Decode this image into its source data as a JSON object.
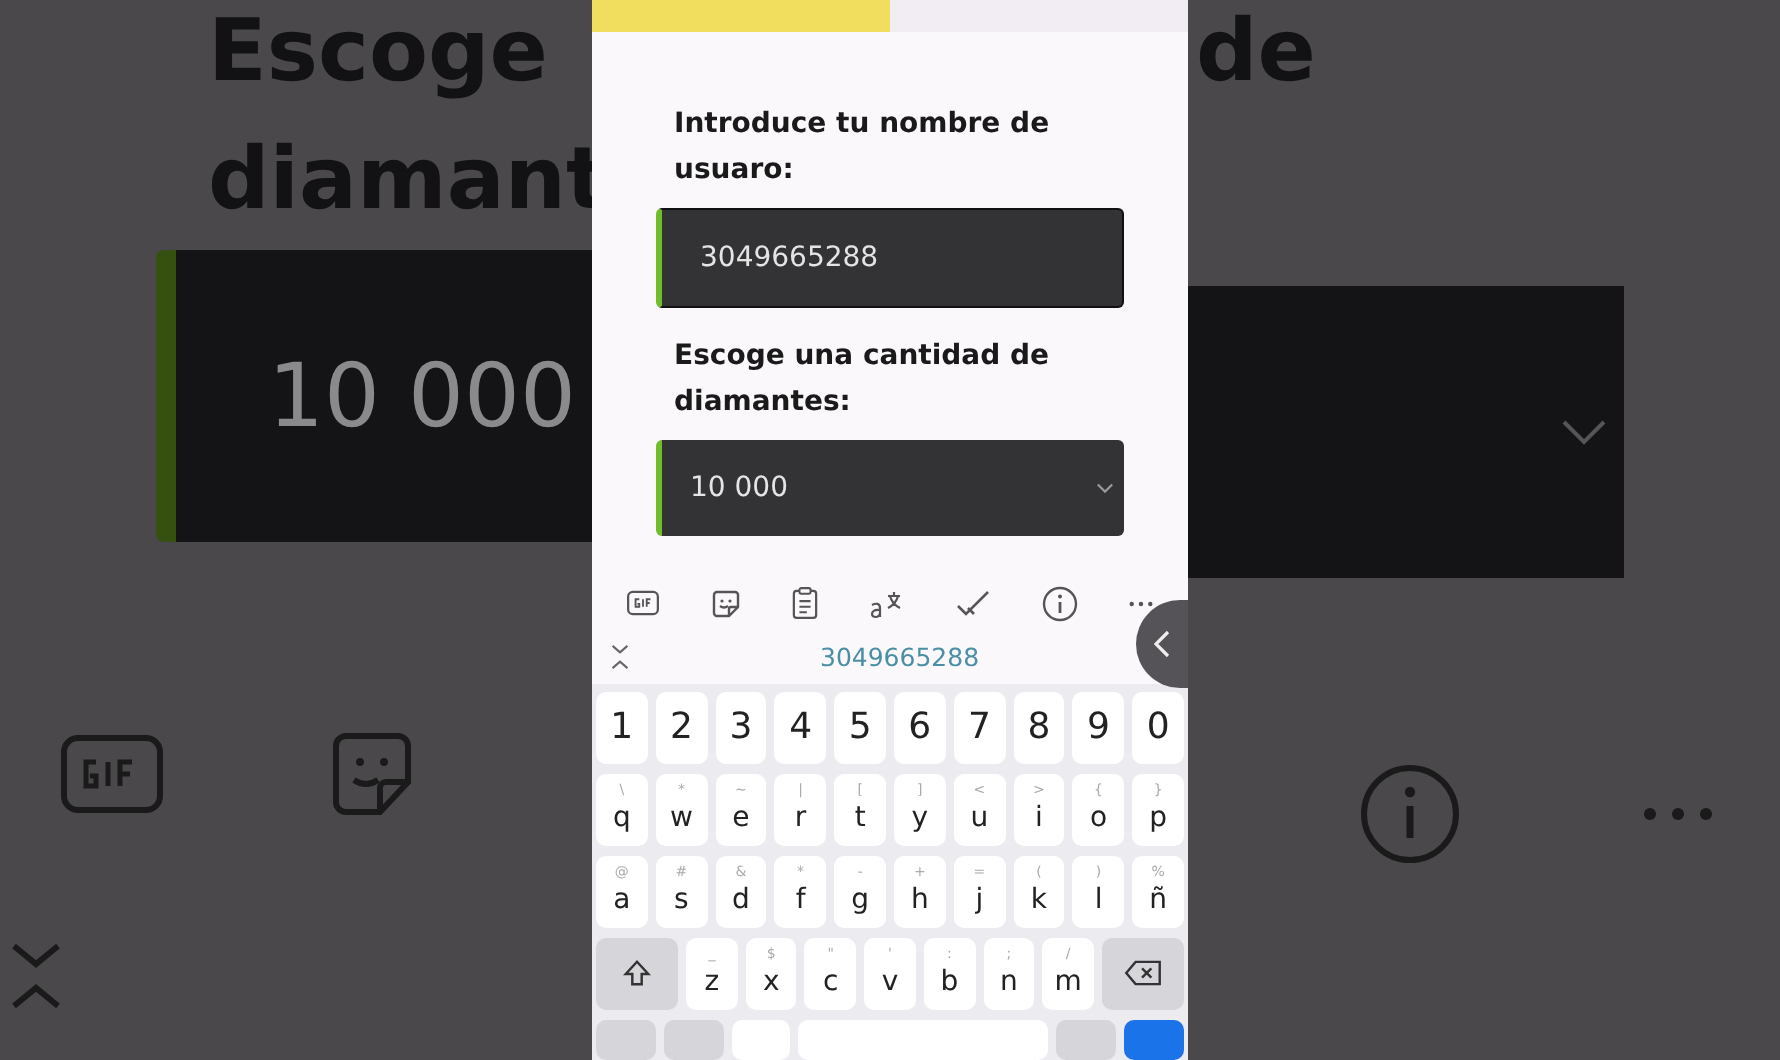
{
  "backdrop": {
    "heading_left": [
      "Escoge",
      "diamant"
    ],
    "heading_right": [
      "de"
    ],
    "amount": "10 000"
  },
  "tabs": [
    {
      "selected": true
    },
    {
      "selected": false
    }
  ],
  "form": {
    "fields": [
      {
        "label": "Introduce tu nombre de usuaro:",
        "kind": "input",
        "value": "3049665288"
      },
      {
        "label": "Escoge una cantidad de diamantes:",
        "kind": "select",
        "value": "10 000"
      }
    ]
  },
  "keyboard": {
    "suggestion": "3049665288",
    "rows": [
      [
        {
          "kind": "char",
          "main": "1"
        },
        {
          "kind": "char",
          "main": "2"
        },
        {
          "kind": "char",
          "main": "3"
        },
        {
          "kind": "char",
          "main": "4"
        },
        {
          "kind": "char",
          "main": "5"
        },
        {
          "kind": "char",
          "main": "6"
        },
        {
          "kind": "char",
          "main": "7"
        },
        {
          "kind": "char",
          "main": "8"
        },
        {
          "kind": "char",
          "main": "9"
        },
        {
          "kind": "char",
          "main": "0"
        }
      ],
      [
        {
          "kind": "char",
          "main": "q",
          "alt": "\\"
        },
        {
          "kind": "char",
          "main": "w",
          "alt": "*"
        },
        {
          "kind": "char",
          "main": "e",
          "alt": "~"
        },
        {
          "kind": "char",
          "main": "r",
          "alt": "|"
        },
        {
          "kind": "char",
          "main": "t",
          "alt": "["
        },
        {
          "kind": "char",
          "main": "y",
          "alt": "]"
        },
        {
          "kind": "char",
          "main": "u",
          "alt": "<"
        },
        {
          "kind": "char",
          "main": "i",
          "alt": ">"
        },
        {
          "kind": "char",
          "main": "o",
          "alt": "{"
        },
        {
          "kind": "char",
          "main": "p",
          "alt": "}"
        }
      ],
      [
        {
          "kind": "char",
          "main": "a",
          "alt": "@"
        },
        {
          "kind": "char",
          "main": "s",
          "alt": "#"
        },
        {
          "kind": "char",
          "main": "d",
          "alt": "&"
        },
        {
          "kind": "char",
          "main": "f",
          "alt": "*"
        },
        {
          "kind": "char",
          "main": "g",
          "alt": "-"
        },
        {
          "kind": "char",
          "main": "h",
          "alt": "+"
        },
        {
          "kind": "char",
          "main": "j",
          "alt": "="
        },
        {
          "kind": "char",
          "main": "k",
          "alt": "("
        },
        {
          "kind": "char",
          "main": "l",
          "alt": ")"
        },
        {
          "kind": "char",
          "main": "ñ",
          "alt": "%"
        }
      ],
      [
        {
          "kind": "shift"
        },
        {
          "kind": "char",
          "main": "z",
          "alt": "_"
        },
        {
          "kind": "char",
          "main": "x",
          "alt": "$"
        },
        {
          "kind": "char",
          "main": "c",
          "alt": "\""
        },
        {
          "kind": "char",
          "main": "v",
          "alt": "'"
        },
        {
          "kind": "char",
          "main": "b",
          "alt": ":"
        },
        {
          "kind": "char",
          "main": "n",
          "alt": ";"
        },
        {
          "kind": "char",
          "main": "m",
          "alt": "/"
        },
        {
          "kind": "backspace"
        }
      ]
    ]
  }
}
